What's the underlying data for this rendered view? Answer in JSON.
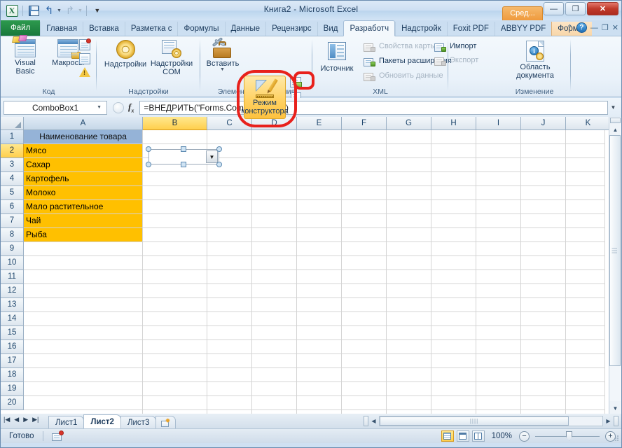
{
  "window": {
    "title": "Книга2  -  Microsoft Excel",
    "minimize": "—",
    "maximize": "❐",
    "close": "✕"
  },
  "quick_access": {
    "logo": "X",
    "save_icon": "save-icon",
    "undo_icon": "undo-arrow-icon",
    "redo_icon": "redo-arrow-icon",
    "customize_icon": "customize-qat-icon"
  },
  "contextual_group": {
    "label": "Сред..."
  },
  "tabs": [
    {
      "label": "Файл",
      "kind": "file"
    },
    {
      "label": "Главная",
      "kind": "normal"
    },
    {
      "label": "Вставка",
      "kind": "normal"
    },
    {
      "label": "Разметка с",
      "kind": "normal"
    },
    {
      "label": "Формулы",
      "kind": "normal"
    },
    {
      "label": "Данные",
      "kind": "normal"
    },
    {
      "label": "Рецензирс",
      "kind": "normal"
    },
    {
      "label": "Вид",
      "kind": "normal"
    },
    {
      "label": "Разработч",
      "kind": "active"
    },
    {
      "label": "Надстройк",
      "kind": "normal"
    },
    {
      "label": "Foxit PDF",
      "kind": "normal"
    },
    {
      "label": "ABBYY PDF",
      "kind": "normal"
    },
    {
      "label": "Формат",
      "kind": "ctx"
    }
  ],
  "tab_right": {
    "collapse_ribbon": "⌃",
    "help": "?",
    "minimize": "—",
    "restore": "❐",
    "close": "✕"
  },
  "ribbon": {
    "groups": [
      {
        "name": "Код",
        "buttons": [
          {
            "label": "Visual Basic",
            "icon": "visual-basic-icon"
          },
          {
            "label": "Макросы",
            "icon": "macros-icon"
          }
        ],
        "small_buttons": [
          {
            "icon": "record-macro-icon"
          },
          {
            "icon": "relative-references-icon"
          },
          {
            "icon": "macro-security-icon"
          }
        ]
      },
      {
        "name": "Надстройки",
        "buttons": [
          {
            "label": "Надстройки",
            "icon": "addins-icon"
          },
          {
            "label": "Надстройки COM",
            "icon": "com-addins-icon"
          }
        ]
      },
      {
        "name": "Элементы управления",
        "buttons": [
          {
            "label": "Вставить",
            "icon": "insert-control-icon"
          },
          {
            "label": "Режим конструктора",
            "icon": "design-mode-icon",
            "state": "active"
          }
        ],
        "small_buttons": [
          {
            "icon": "properties-icon"
          },
          {
            "icon": "view-code-icon"
          },
          {
            "icon": "run-dialog-icon"
          }
        ]
      },
      {
        "name": "XML",
        "buttons": [
          {
            "label": "Источник",
            "icon": "xml-source-icon"
          }
        ],
        "rows": [
          {
            "label": "Свойства карты",
            "icon": "map-properties-icon",
            "disabled": true
          },
          {
            "label": "Пакеты расширения",
            "icon": "expansion-packs-icon",
            "disabled": false
          },
          {
            "label": "Обновить данные",
            "icon": "refresh-data-icon",
            "disabled": true
          },
          {
            "label": "Импорт",
            "icon": "import-icon",
            "disabled": false
          },
          {
            "label": "Экспорт",
            "icon": "export-icon",
            "disabled": true
          }
        ]
      },
      {
        "name": "Изменение",
        "buttons": [
          {
            "label": "Область документа",
            "icon": "document-panel-icon"
          }
        ]
      }
    ]
  },
  "annotations": [
    {
      "shape": "rounded-rect",
      "color": "#e8211c",
      "target": "Режим конструктора"
    },
    {
      "shape": "rounded-rect",
      "color": "#e8211c",
      "target": "properties-icon"
    }
  ],
  "formula_bar": {
    "name_box": "ComboBox1",
    "formula": "=ВНЕДРИТЬ(\"Forms.ComboBox.1\";\"\")",
    "fx_label": "fx",
    "cancel_icon": "cancel-icon",
    "expand_icon": "expand-formula-bar-icon"
  },
  "grid": {
    "columns": [
      "A",
      "B",
      "C",
      "D",
      "E",
      "F",
      "G",
      "H",
      "I",
      "J",
      "K"
    ],
    "selected_column": "B",
    "rows": [
      1,
      2,
      3,
      4,
      5,
      6,
      7,
      8,
      9,
      10,
      11,
      12,
      13,
      14,
      15,
      16,
      17,
      18,
      19,
      20
    ],
    "selected_row": 2,
    "column_a_header": "Наименование товара",
    "column_a_values": [
      "Мясо",
      "Сахар",
      "Картофель",
      "Молоко",
      "Мало растительное",
      "Чай",
      "Рыба"
    ],
    "header_fill": "#95b3d7",
    "data_fill": "#ffc000",
    "combobox": {
      "name": "ComboBox1",
      "value": "",
      "arrow": "▼"
    }
  },
  "sheet_tabs": {
    "nav_first": "|◀",
    "nav_prev": "◀",
    "nav_next": "▶",
    "nav_last": "▶|",
    "sheets": [
      "Лист1",
      "Лист2",
      "Лист3"
    ],
    "active": "Лист2",
    "new_sheet_icon": "new-sheet-icon"
  },
  "status_bar": {
    "status": "Готово",
    "macro_record_icon": "record-macro-status-icon",
    "views": [
      {
        "name": "normal-view",
        "active": true
      },
      {
        "name": "page-layout-view",
        "active": false
      },
      {
        "name": "page-break-view",
        "active": false
      }
    ],
    "zoom": "100%",
    "zoom_out": "−",
    "zoom_in": "+"
  }
}
